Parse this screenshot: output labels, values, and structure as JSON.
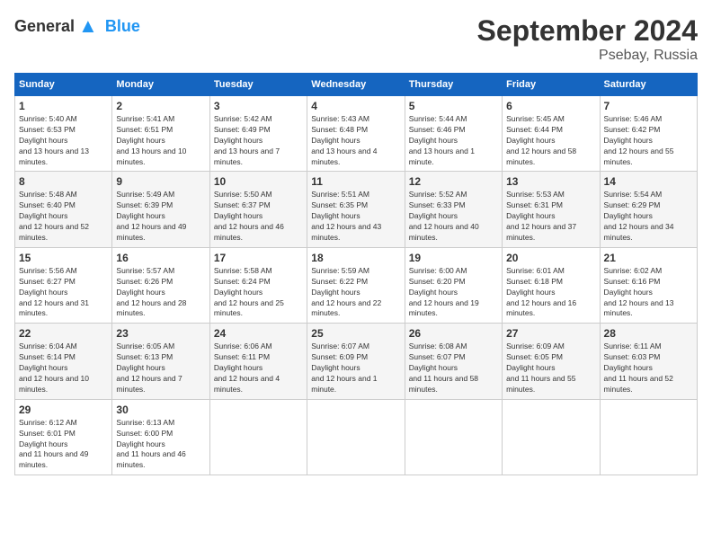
{
  "header": {
    "logo_general": "General",
    "logo_blue": "Blue",
    "month_title": "September 2024",
    "location": "Psebay, Russia"
  },
  "days_of_week": [
    "Sunday",
    "Monday",
    "Tuesday",
    "Wednesday",
    "Thursday",
    "Friday",
    "Saturday"
  ],
  "weeks": [
    [
      {
        "day": "1",
        "sunrise": "5:40 AM",
        "sunset": "6:53 PM",
        "daylight": "13 hours and 13 minutes."
      },
      {
        "day": "2",
        "sunrise": "5:41 AM",
        "sunset": "6:51 PM",
        "daylight": "13 hours and 10 minutes."
      },
      {
        "day": "3",
        "sunrise": "5:42 AM",
        "sunset": "6:49 PM",
        "daylight": "13 hours and 7 minutes."
      },
      {
        "day": "4",
        "sunrise": "5:43 AM",
        "sunset": "6:48 PM",
        "daylight": "13 hours and 4 minutes."
      },
      {
        "day": "5",
        "sunrise": "5:44 AM",
        "sunset": "6:46 PM",
        "daylight": "13 hours and 1 minute."
      },
      {
        "day": "6",
        "sunrise": "5:45 AM",
        "sunset": "6:44 PM",
        "daylight": "12 hours and 58 minutes."
      },
      {
        "day": "7",
        "sunrise": "5:46 AM",
        "sunset": "6:42 PM",
        "daylight": "12 hours and 55 minutes."
      }
    ],
    [
      {
        "day": "8",
        "sunrise": "5:48 AM",
        "sunset": "6:40 PM",
        "daylight": "12 hours and 52 minutes."
      },
      {
        "day": "9",
        "sunrise": "5:49 AM",
        "sunset": "6:39 PM",
        "daylight": "12 hours and 49 minutes."
      },
      {
        "day": "10",
        "sunrise": "5:50 AM",
        "sunset": "6:37 PM",
        "daylight": "12 hours and 46 minutes."
      },
      {
        "day": "11",
        "sunrise": "5:51 AM",
        "sunset": "6:35 PM",
        "daylight": "12 hours and 43 minutes."
      },
      {
        "day": "12",
        "sunrise": "5:52 AM",
        "sunset": "6:33 PM",
        "daylight": "12 hours and 40 minutes."
      },
      {
        "day": "13",
        "sunrise": "5:53 AM",
        "sunset": "6:31 PM",
        "daylight": "12 hours and 37 minutes."
      },
      {
        "day": "14",
        "sunrise": "5:54 AM",
        "sunset": "6:29 PM",
        "daylight": "12 hours and 34 minutes."
      }
    ],
    [
      {
        "day": "15",
        "sunrise": "5:56 AM",
        "sunset": "6:27 PM",
        "daylight": "12 hours and 31 minutes."
      },
      {
        "day": "16",
        "sunrise": "5:57 AM",
        "sunset": "6:26 PM",
        "daylight": "12 hours and 28 minutes."
      },
      {
        "day": "17",
        "sunrise": "5:58 AM",
        "sunset": "6:24 PM",
        "daylight": "12 hours and 25 minutes."
      },
      {
        "day": "18",
        "sunrise": "5:59 AM",
        "sunset": "6:22 PM",
        "daylight": "12 hours and 22 minutes."
      },
      {
        "day": "19",
        "sunrise": "6:00 AM",
        "sunset": "6:20 PM",
        "daylight": "12 hours and 19 minutes."
      },
      {
        "day": "20",
        "sunrise": "6:01 AM",
        "sunset": "6:18 PM",
        "daylight": "12 hours and 16 minutes."
      },
      {
        "day": "21",
        "sunrise": "6:02 AM",
        "sunset": "6:16 PM",
        "daylight": "12 hours and 13 minutes."
      }
    ],
    [
      {
        "day": "22",
        "sunrise": "6:04 AM",
        "sunset": "6:14 PM",
        "daylight": "12 hours and 10 minutes."
      },
      {
        "day": "23",
        "sunrise": "6:05 AM",
        "sunset": "6:13 PM",
        "daylight": "12 hours and 7 minutes."
      },
      {
        "day": "24",
        "sunrise": "6:06 AM",
        "sunset": "6:11 PM",
        "daylight": "12 hours and 4 minutes."
      },
      {
        "day": "25",
        "sunrise": "6:07 AM",
        "sunset": "6:09 PM",
        "daylight": "12 hours and 1 minute."
      },
      {
        "day": "26",
        "sunrise": "6:08 AM",
        "sunset": "6:07 PM",
        "daylight": "11 hours and 58 minutes."
      },
      {
        "day": "27",
        "sunrise": "6:09 AM",
        "sunset": "6:05 PM",
        "daylight": "11 hours and 55 minutes."
      },
      {
        "day": "28",
        "sunrise": "6:11 AM",
        "sunset": "6:03 PM",
        "daylight": "11 hours and 52 minutes."
      }
    ],
    [
      {
        "day": "29",
        "sunrise": "6:12 AM",
        "sunset": "6:01 PM",
        "daylight": "11 hours and 49 minutes."
      },
      {
        "day": "30",
        "sunrise": "6:13 AM",
        "sunset": "6:00 PM",
        "daylight": "11 hours and 46 minutes."
      },
      null,
      null,
      null,
      null,
      null
    ]
  ]
}
